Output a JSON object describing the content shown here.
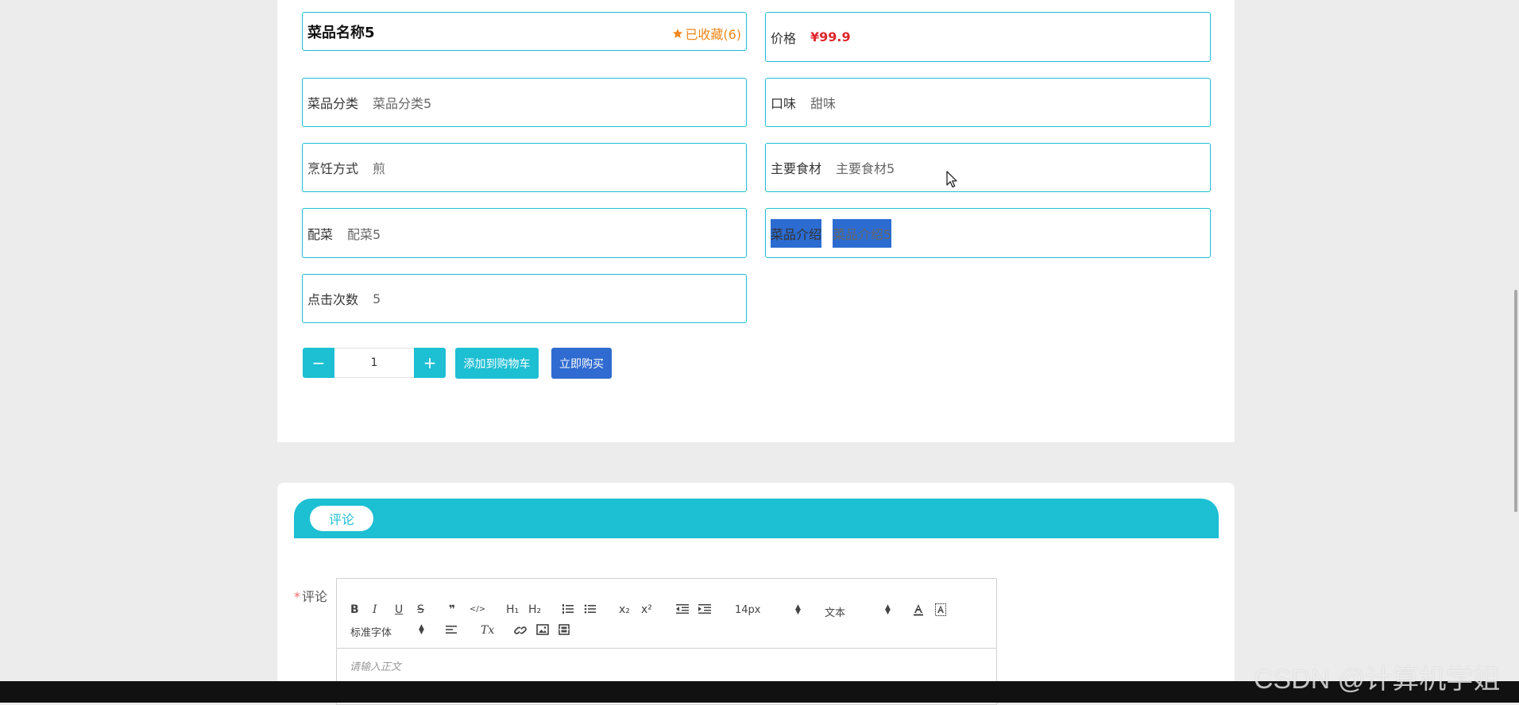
{
  "product": {
    "name": "菜品名称5",
    "favorite": "已收藏(6)",
    "price_label": "价格",
    "price_value": "¥99.9",
    "fields": [
      {
        "label": "菜品分类",
        "value": "菜品分类5"
      },
      {
        "label": "口味",
        "value": "甜味"
      },
      {
        "label": "烹饪方式",
        "value": "煎"
      },
      {
        "label": "主要食材",
        "value": "主要食材5"
      },
      {
        "label": "配菜",
        "value": "配菜5"
      },
      {
        "label": "菜品介绍",
        "value": "菜品介绍5"
      },
      {
        "label": "点击次数",
        "value": "5"
      }
    ]
  },
  "purchase": {
    "minus": "−",
    "quantity": "1",
    "plus": "+",
    "add_to_cart": "添加到购物车",
    "buy_now": "立即购买"
  },
  "comments": {
    "tab": "评论",
    "label": "评论",
    "required_mark": "*",
    "placeholder": "请输入正文",
    "toolbar": {
      "bold": "B",
      "italic": "I",
      "underline": "U",
      "strike": "S",
      "quote": "❞",
      "code": "</>",
      "h1": "H₁",
      "h2": "H₂",
      "sub": "x₂",
      "sup": "x²",
      "font_size": "14px",
      "text_type": "文本",
      "font_family": "标准字体",
      "clean": "Tx"
    }
  },
  "watermark": "CSDN @计算机学姐",
  "colors": {
    "accent": "#1dbfd3",
    "buy": "#2f6bd0",
    "price": "#e0262c",
    "favorite": "#f0871a"
  }
}
